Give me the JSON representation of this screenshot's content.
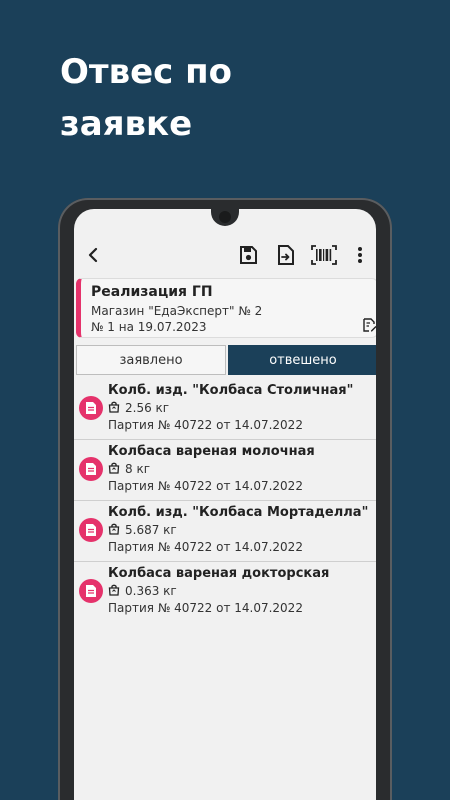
{
  "promo": {
    "title": "Отвес по заявке"
  },
  "document": {
    "title": "Реализация ГП",
    "store": "Магазин \"ЕдаЭксперт\" № 2",
    "number": "№ 1 на 19.07.2023"
  },
  "tabs": [
    {
      "label": "заявлено",
      "active": false
    },
    {
      "label": "отвешено",
      "active": true
    }
  ],
  "items": [
    {
      "name": "Колб. изд. \"Колбаса Столичная\"",
      "weight": "2.56 кг",
      "batch": "Партия № 40722 от 14.07.2022"
    },
    {
      "name": "Колбаса вареная молочная",
      "weight": "8 кг",
      "batch": "Партия № 40722 от 14.07.2022"
    },
    {
      "name": "Колб. изд. \"Колбаса Мортаделла\"",
      "weight": "5.687 кг",
      "batch": "Партия № 40722 от 14.07.2022"
    },
    {
      "name": "Колбаса вареная докторская",
      "weight": "0.363 кг",
      "batch": "Партия № 40722 от 14.07.2022"
    }
  ],
  "icons": {
    "back": "back-arrow-icon",
    "save": "save-icon",
    "export": "export-file-icon",
    "barcode": "barcode-scan-icon",
    "more": "more-vertical-icon",
    "edit": "edit-document-icon",
    "item": "document-icon",
    "weight": "weight-bag-icon"
  },
  "colors": {
    "background": "#1b4059",
    "accent": "#e5326b",
    "active_tab": "#1b4059"
  }
}
